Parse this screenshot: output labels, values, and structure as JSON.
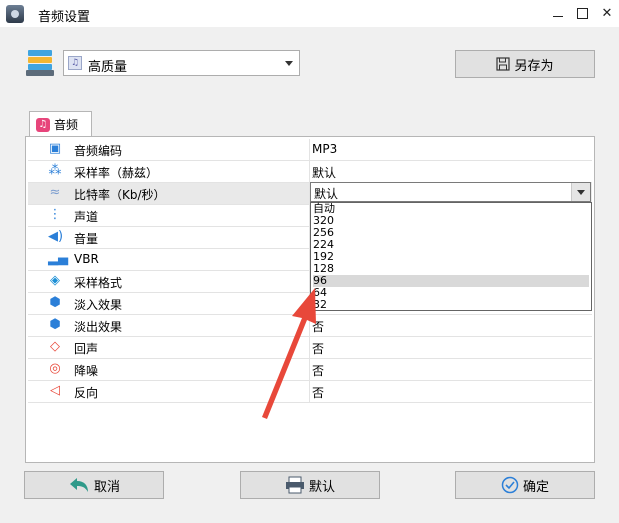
{
  "window": {
    "title": "音频设置"
  },
  "toolbar": {
    "preset_value": "高质量",
    "save_as_label": "另存为"
  },
  "tab": {
    "label": "音频"
  },
  "properties": [
    {
      "name": "音频编码",
      "value": "MP3",
      "icon": "chip-icon"
    },
    {
      "name": "采样率（赫兹）",
      "value": "默认",
      "icon": "sample-rate-icon"
    },
    {
      "name": "比特率（Kb/秒）",
      "value": "默认",
      "icon": "wave-icon"
    },
    {
      "name": "声道",
      "value": "",
      "icon": "channel-icon"
    },
    {
      "name": "音量",
      "value": "",
      "icon": "speaker-icon"
    },
    {
      "name": "VBR",
      "value": "",
      "icon": "bars-icon"
    },
    {
      "name": "采样格式",
      "value": "",
      "icon": "cube-icon"
    },
    {
      "name": "淡入效果",
      "value": "",
      "icon": "hexagon-icon"
    },
    {
      "name": "淡出效果",
      "value": "否",
      "icon": "hexagon-icon"
    },
    {
      "name": "回声",
      "value": "否",
      "icon": "echo-icon"
    },
    {
      "name": "降噪",
      "value": "否",
      "icon": "noise-icon"
    },
    {
      "name": "反向",
      "value": "否",
      "icon": "reverse-icon"
    }
  ],
  "bitrate_dropdown": {
    "current": "默认",
    "options": [
      "自动",
      "320",
      "256",
      "224",
      "192",
      "128",
      "96",
      "64",
      "32"
    ],
    "highlighted": "96"
  },
  "buttons": {
    "cancel": "取消",
    "default": "默认",
    "ok": "确定"
  },
  "colors": {
    "accent": "#2b7fd8",
    "arrow": "#e8483a",
    "tab_icon": "#e7457b"
  }
}
